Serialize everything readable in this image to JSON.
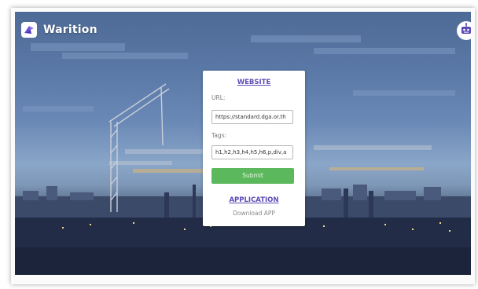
{
  "app": {
    "name": "Warition",
    "logo_icon": "origami-bird-icon",
    "assistant_icon": "robot-icon"
  },
  "card": {
    "website_heading": "WEBSITE",
    "url_label": "URL:",
    "url_value": "https://standard.dga.or.th",
    "tags_label": "Tags:",
    "tags_value": "h1,h2,h3,h4,h5,h6,p,div,a",
    "submit_label": "Submit",
    "application_heading": "APPLICATION",
    "download_label": "Download APP"
  },
  "colors": {
    "accent": "#5b4bb5",
    "submit": "#5cb85c",
    "brand_logo": "#6b4fd8"
  }
}
